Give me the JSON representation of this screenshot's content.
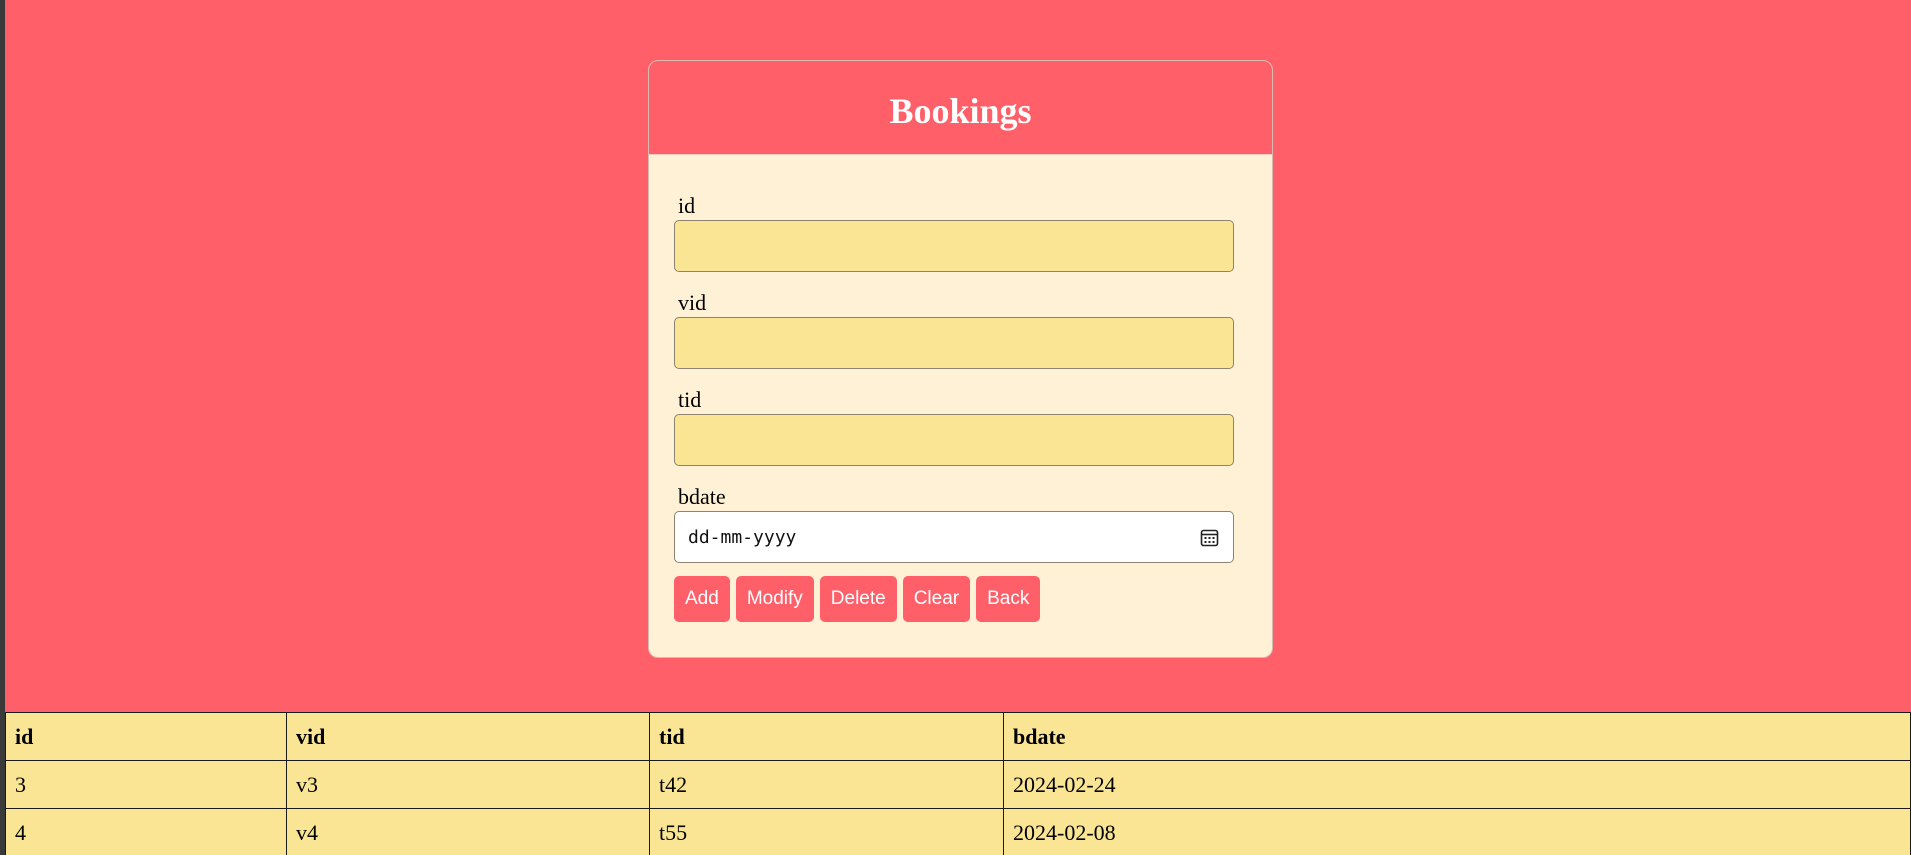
{
  "form": {
    "title": "Bookings",
    "fields": [
      {
        "label": "id",
        "value": ""
      },
      {
        "label": "vid",
        "value": ""
      },
      {
        "label": "tid",
        "value": ""
      },
      {
        "label": "bdate",
        "placeholder": "dd-mm-yyyy"
      }
    ],
    "buttons": [
      "Add",
      "Modify",
      "Delete",
      "Clear",
      "Back"
    ]
  },
  "table": {
    "columns": [
      "id",
      "vid",
      "tid",
      "bdate"
    ],
    "rows": [
      [
        "3",
        "v3",
        "t42",
        "2024-02-24"
      ],
      [
        "4",
        "v4",
        "t55",
        "2024-02-08"
      ]
    ]
  },
  "icons": {
    "date_picker": "calendar-icon"
  },
  "colors": {
    "background": "#fe5f68",
    "card_body": "#fff1d6",
    "input_fill": "#f9e593",
    "button": "#fe5f68",
    "table_fill": "#f9e593"
  }
}
